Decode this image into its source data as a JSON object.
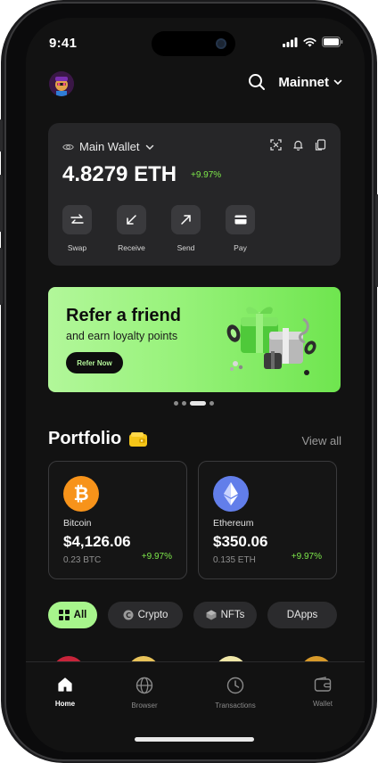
{
  "status_bar": {
    "time": "9:41"
  },
  "header": {
    "network": "Mainnet"
  },
  "wallet": {
    "name": "Main Wallet",
    "balance": "4.8279 ETH",
    "change": "+9.97%",
    "actions": [
      {
        "label": "Swap",
        "icon": "swap-icon"
      },
      {
        "label": "Receive",
        "icon": "arrow-down-left-icon"
      },
      {
        "label": "Send",
        "icon": "arrow-up-right-icon"
      },
      {
        "label": "Pay",
        "icon": "card-icon"
      }
    ]
  },
  "banner": {
    "title": "Refer a friend",
    "subtitle": "and earn loyalty points",
    "button": "Refer Now",
    "active_slide": 3,
    "slide_count": 4
  },
  "portfolio": {
    "title": "Portfolio",
    "view_all": "View all",
    "coins": [
      {
        "name": "Bitcoin",
        "value": "$4,126.06",
        "amount": "0.23 BTC",
        "change": "+9.97%",
        "color": "#f7931a"
      },
      {
        "name": "Ethereum",
        "value": "$350.06",
        "amount": "0.135 ETH",
        "change": "+9.97%",
        "color": "#627eea"
      }
    ]
  },
  "filters": [
    {
      "label": "All",
      "active": true
    },
    {
      "label": "Crypto",
      "active": false
    },
    {
      "label": "NFTs",
      "active": false
    },
    {
      "label": "DApps",
      "active": false
    }
  ],
  "tabs": [
    {
      "label": "Home",
      "active": true
    },
    {
      "label": "Browser",
      "active": false
    },
    {
      "label": "Transactions",
      "active": false
    },
    {
      "label": "Wallet",
      "active": false
    }
  ],
  "colors": {
    "accent_green": "#a7f58c",
    "positive": "#7ee84b",
    "background": "#121212",
    "card": "#262628"
  }
}
